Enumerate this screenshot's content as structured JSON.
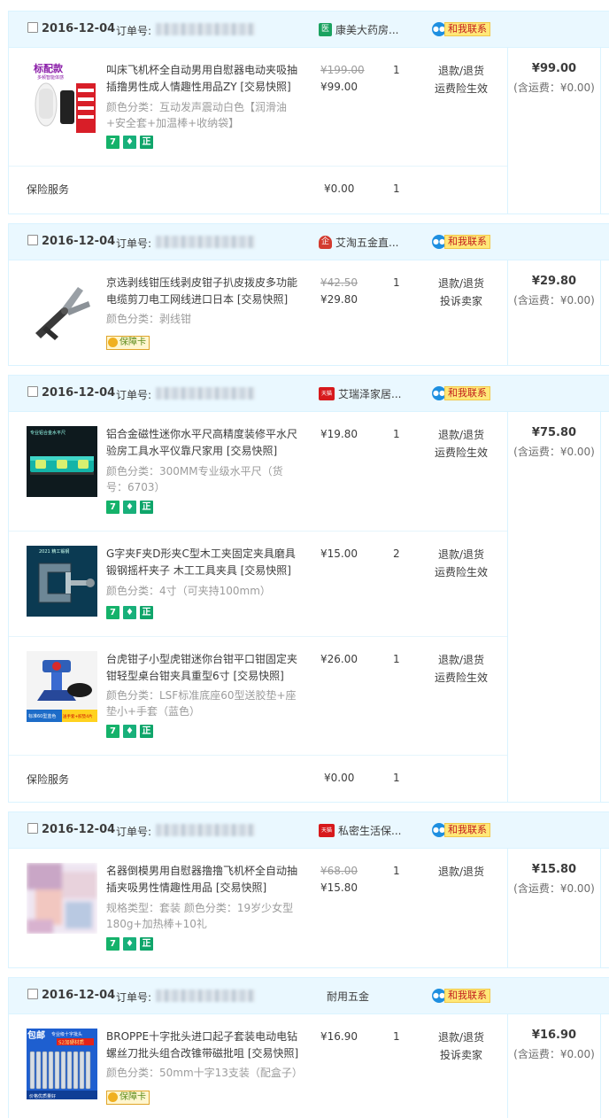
{
  "common": {
    "order_no_label": "订单号:",
    "contact_label": "和我联系",
    "insurance_label": "保险服务",
    "tag_seven": "7",
    "tag_zheng": "正",
    "guarantee_card": "保障卡"
  },
  "orders": [
    {
      "date": "2016-12-04",
      "shop": {
        "name": "康美大药房...",
        "badge": "医",
        "badge_color": "#1aa260"
      },
      "total": "¥99.00",
      "shipping": "(含运费：¥0.00)",
      "items": [
        {
          "title": "叫床飞机杯全自动男用自慰器电动夹吸抽插撸男性成人情趣性用品ZY [交易快照]",
          "spec": "颜色分类：互动发声震动白色【润滑油+安全套+加温棒+收纳袋】",
          "price_old": "¥199.00",
          "price": "¥99.00",
          "qty": "1",
          "actions": [
            "退款/退货",
            "运费险生效"
          ]
        }
      ],
      "insurance": {
        "price": "¥0.00",
        "qty": "1"
      }
    },
    {
      "date": "2016-12-04",
      "shop": {
        "name": "艾淘五金直...",
        "badge": "企",
        "badge_color": "#d33b2f"
      },
      "total": "¥29.80",
      "shipping": "(含运费：¥0.00)",
      "items": [
        {
          "title": "京选剥线钳压线剥皮钳子扒皮拨皮多功能电缆剪刀电工网线进口日本 [交易快照]",
          "spec": "颜色分类：剥线钳",
          "price_old": "¥42.50",
          "price": "¥29.80",
          "qty": "1",
          "actions": [
            "退款/退货",
            "投诉卖家"
          ]
        }
      ]
    },
    {
      "date": "2016-12-04",
      "shop": {
        "name": "艾瑞泽家居...",
        "badge": "天猫",
        "badge_color": "#d7191c"
      },
      "total": "¥75.80",
      "shipping": "(含运费：¥0.00)",
      "items": [
        {
          "title": "铝合金磁性迷你水平尺高精度装修平水尺验房工具水平仪靠尺家用 [交易快照]",
          "spec": "颜色分类：300MM专业级水平尺（货号：6703）",
          "price": "¥19.80",
          "qty": "1",
          "actions": [
            "退款/退货",
            "运费险生效"
          ]
        },
        {
          "title": "G字夹F夹D形夹C型木工夹固定夹具磨具锻钢摇杆夹子 木工工具夹具 [交易快照]",
          "spec": "颜色分类：4寸（可夹持100mm）",
          "price": "¥15.00",
          "qty": "2",
          "actions": [
            "退款/退货",
            "运费险生效"
          ]
        },
        {
          "title": "台虎钳子小型虎钳迷你台钳平口钳固定夹钳轻型桌台钳夹具重型6寸 [交易快照]",
          "spec": "颜色分类：LSF标准底座60型送胶垫+座垫小+手套（蓝色）",
          "price": "¥26.00",
          "qty": "1",
          "actions": [
            "退款/退货",
            "运费险生效"
          ]
        }
      ],
      "insurance": {
        "price": "¥0.00",
        "qty": "1"
      }
    },
    {
      "date": "2016-12-04",
      "shop": {
        "name": "私密生活保...",
        "badge": "天猫",
        "badge_color": "#d7191c"
      },
      "total": "¥15.80",
      "shipping": "(含运费：¥0.00)",
      "items": [
        {
          "title": "名器倒模男用自慰器撸撸飞机杯全自动抽插夹吸男性情趣性用品 [交易快照]",
          "spec": "规格类型：套装  颜色分类：19岁少女型180g+加热棒+10礼",
          "price_old": "¥68.00",
          "price": "¥15.80",
          "qty": "1",
          "actions": [
            "退款/退货"
          ]
        }
      ]
    },
    {
      "date": "2016-12-04",
      "shop": {
        "name": "耐用五金",
        "badge": "",
        "badge_color": ""
      },
      "total": "¥16.90",
      "shipping": "(含运费：¥0.00)",
      "items": [
        {
          "title": "BROPPE十字批头进口起子套装电动电钻螺丝刀批头组合改锥带磁批咀 [交易快照]",
          "spec": "颜色分类：50mm十字13支装（配盒子）",
          "price": "¥16.90",
          "qty": "1",
          "actions": [
            "退款/退货",
            "投诉卖家"
          ]
        }
      ]
    }
  ],
  "thumb_text": {
    "t1_top": "标配款",
    "t1_sub": "多频智能体感",
    "t3_label": "专业铝合金水平尺",
    "t4_label": "2021 精工锻钢",
    "t5_caption": "标准60型蓝色",
    "t5_tag": "送手套+胶垫4片",
    "t7_a": "包邮",
    "t7_b": "专业级十字批头",
    "t7_c": "S2加硬材质",
    "t7_d": "价格优质量好"
  },
  "colors": {
    "header_bg": "#eaf8ff",
    "border": "#daf3ff",
    "contact_bg": "#ffe878",
    "contact_text": "#c21d1d"
  }
}
